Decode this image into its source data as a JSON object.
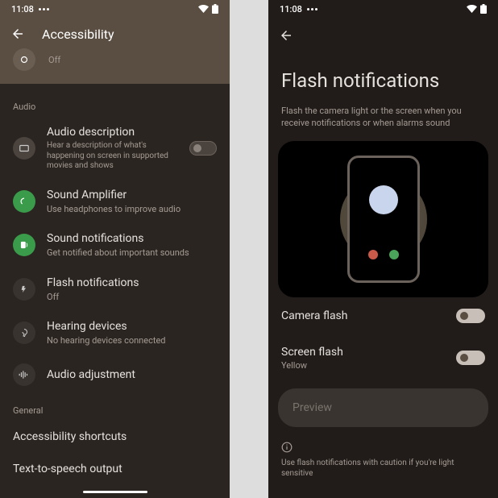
{
  "status": {
    "time": "11:08"
  },
  "left": {
    "title": "Accessibility",
    "partial_sub": "Off",
    "sections": {
      "audio": {
        "label": "Audio",
        "items": [
          {
            "title": "Audio description",
            "sub": "Hear a description of what's happening on screen in supported movies and shows"
          },
          {
            "title": "Sound Amplifier",
            "sub": "Use headphones to improve audio"
          },
          {
            "title": "Sound notifications",
            "sub": "Get notified about important sounds"
          },
          {
            "title": "Flash notifications",
            "sub": "Off"
          },
          {
            "title": "Hearing devices",
            "sub": "No hearing devices connected"
          },
          {
            "title": "Audio adjustment",
            "sub": ""
          }
        ]
      },
      "general": {
        "label": "General",
        "items": [
          {
            "title": "Accessibility shortcuts"
          },
          {
            "title": "Text-to-speech output"
          }
        ]
      }
    }
  },
  "right": {
    "title": "Flash notifications",
    "desc": "Flash the camera light or the screen when you receive notifications or when alarms sound",
    "rows": {
      "camera": {
        "title": "Camera flash"
      },
      "screen": {
        "title": "Screen flash",
        "sub": "Yellow"
      }
    },
    "preview": "Preview",
    "caution": "Use flash notifications with caution if you're light sensitive"
  }
}
